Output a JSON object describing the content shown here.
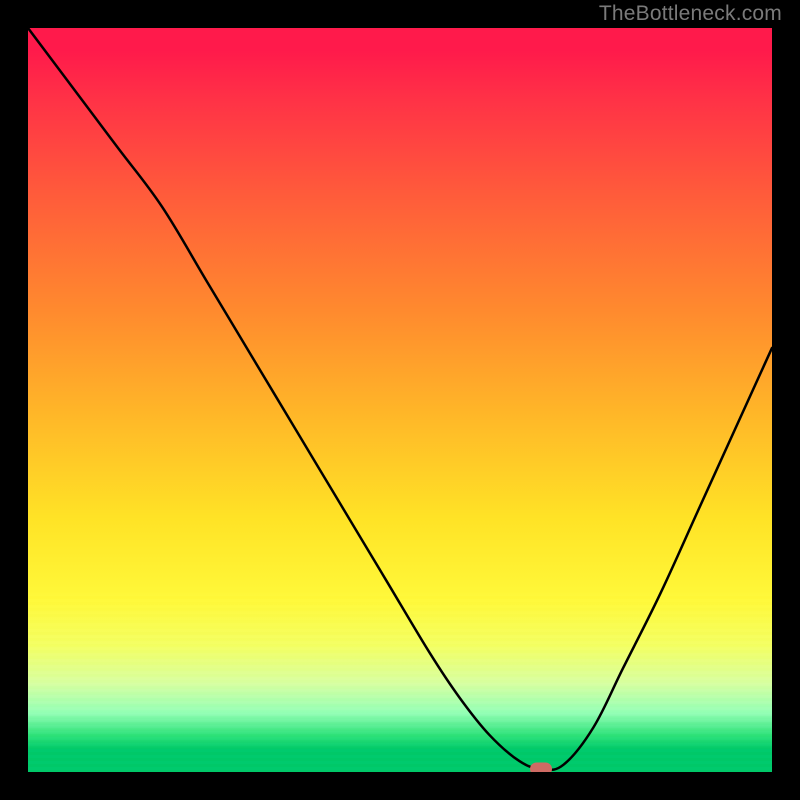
{
  "watermark": "TheBottleneck.com",
  "chart_data": {
    "type": "line",
    "title": "",
    "xlabel": "",
    "ylabel": "",
    "xlim": [
      0,
      100
    ],
    "ylim": [
      0,
      100
    ],
    "grid": false,
    "series": [
      {
        "name": "bottleneck-curve",
        "x": [
          0,
          6,
          12,
          18,
          24,
          30,
          36,
          42,
          48,
          54,
          58,
          62,
          66,
          69,
          72,
          76,
          80,
          85,
          90,
          95,
          100
        ],
        "values": [
          100,
          92,
          84,
          76,
          66,
          56,
          46,
          36,
          26,
          16,
          10,
          5,
          1.5,
          0.4,
          1,
          6,
          14,
          24,
          35,
          46,
          57
        ]
      }
    ],
    "marker": {
      "x": 69,
      "y": 0.4
    },
    "background_gradient": {
      "top": "#ff1a4b",
      "mid": "#ffe326",
      "bottom": "#00c96a"
    },
    "curve_color": "#000000",
    "marker_color": "#cf6b64"
  }
}
